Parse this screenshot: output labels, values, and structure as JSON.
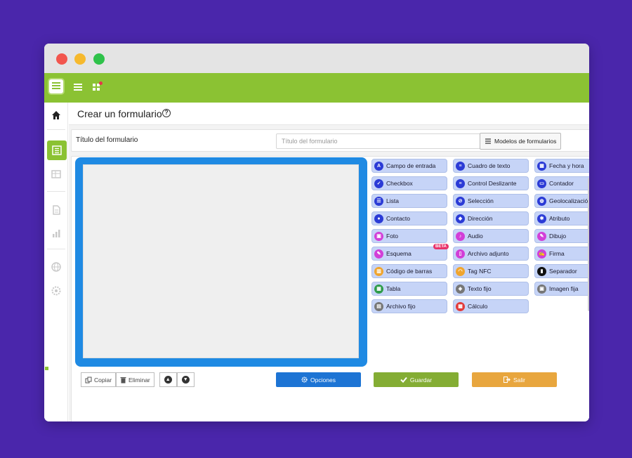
{
  "header": {
    "title": "Crear un formulario"
  },
  "form": {
    "label": "Título del formulario",
    "placeholder": "Título del formulario",
    "models_button": "Modelos de formularios"
  },
  "palette": {
    "items": [
      {
        "label": "Campo de entrada",
        "icon": "text-input-icon",
        "glyph": "A",
        "color": "#2b3bd6"
      },
      {
        "label": "Cuadro de texto",
        "icon": "textbox-icon",
        "glyph": "≡",
        "color": "#2b3bd6"
      },
      {
        "label": "Fecha y hora",
        "icon": "calendar-icon",
        "glyph": "▦",
        "color": "#2b3bd6"
      },
      {
        "label": "Checkbox",
        "icon": "checkbox-icon",
        "glyph": "✓",
        "color": "#2b3bd6"
      },
      {
        "label": "Control Deslizante",
        "icon": "slider-icon",
        "glyph": "≡",
        "color": "#2b3bd6"
      },
      {
        "label": "Contador",
        "icon": "counter-icon",
        "glyph": "▭",
        "color": "#2b3bd6"
      },
      {
        "label": "Lista",
        "icon": "list-icon",
        "glyph": "☰",
        "color": "#2b3bd6"
      },
      {
        "label": "Selección",
        "icon": "selection-icon",
        "glyph": "⊘",
        "color": "#2b3bd6"
      },
      {
        "label": "Geolocalización",
        "icon": "globe-icon",
        "glyph": "◍",
        "color": "#2b3bd6"
      },
      {
        "label": "Contacto",
        "icon": "contact-icon",
        "glyph": "●",
        "color": "#2b3bd6"
      },
      {
        "label": "Dirección",
        "icon": "address-icon",
        "glyph": "◆",
        "color": "#2b3bd6"
      },
      {
        "label": "Atributo",
        "icon": "attribute-icon",
        "glyph": "✱",
        "color": "#2b3bd6"
      },
      {
        "label": "Foto",
        "icon": "photo-icon",
        "glyph": "▣",
        "color": "#d23fd8"
      },
      {
        "label": "Audio",
        "icon": "microphone-icon",
        "glyph": "♪",
        "color": "#d23fd8"
      },
      {
        "label": "Dibujo",
        "icon": "brush-icon",
        "glyph": "✎",
        "color": "#d23fd8"
      },
      {
        "label": "Esquema",
        "icon": "pencil-icon",
        "glyph": "✎",
        "color": "#d23fd8"
      },
      {
        "label": "Archivo adjunto",
        "icon": "attachment-icon",
        "glyph": "▯",
        "color": "#d23fd8"
      },
      {
        "label": "Firma",
        "icon": "signature-icon",
        "glyph": "✍",
        "color": "#d23fd8"
      },
      {
        "label": "Código de barras",
        "icon": "barcode-icon",
        "glyph": "▥",
        "color": "#f0a52e"
      },
      {
        "label": "Tag NFC",
        "icon": "nfc-icon",
        "glyph": "◠",
        "color": "#f0a52e"
      },
      {
        "label": "Separador",
        "icon": "separator-icon",
        "glyph": "▮",
        "color": "#111111"
      },
      {
        "label": "Tabla",
        "icon": "table-icon",
        "glyph": "▦",
        "color": "#2f9c4a"
      },
      {
        "label": "Texto fijo",
        "icon": "fixed-text-icon",
        "glyph": "◈",
        "color": "#777777"
      },
      {
        "label": "Imagen fija",
        "icon": "fixed-image-icon",
        "glyph": "▣",
        "color": "#777777"
      },
      {
        "label": "Archivo fijo",
        "icon": "fixed-file-icon",
        "glyph": "▤",
        "color": "#777777"
      },
      {
        "label": "Cálculo",
        "icon": "calculator-icon",
        "glyph": "▦",
        "color": "#e23b3b"
      }
    ],
    "beta_badge": "BETA"
  },
  "toolbar": {
    "copy_label": "Copiar",
    "delete_label": "Eliminar",
    "up_glyph": "▲",
    "down_glyph": "▼"
  },
  "actions": {
    "options_label": "Opciones",
    "save_label": "Guardar",
    "exit_label": "Salir"
  },
  "colors": {
    "brand_green": "#8bc233",
    "canvas_blue": "#1f8ae3",
    "palette_bg": "#c6d4f7",
    "options": "#1d74d4",
    "save": "#84ad34",
    "exit": "#e8a63e"
  }
}
